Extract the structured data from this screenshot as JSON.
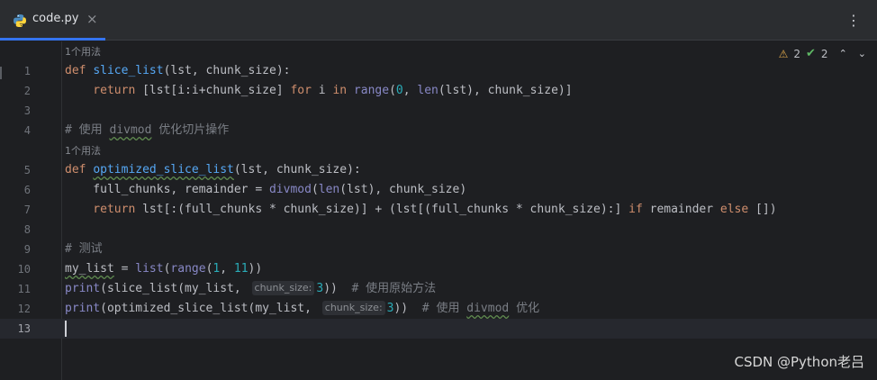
{
  "tab": {
    "label": "code.py",
    "close": "×"
  },
  "menu": {
    "kebab": "⋮"
  },
  "inspections": {
    "warnings": "2",
    "ok": "2",
    "up": "⌃",
    "down": "⌄"
  },
  "usage_hint": "1个用法",
  "inlay_hint": "chunk_size:",
  "lines": {
    "l1": {
      "n": "1",
      "a": "def ",
      "b": "slice_list",
      "c": "(lst, chunk_size):"
    },
    "l2": {
      "n": "2",
      "a": "    return ",
      "b": "[lst[i:i+chunk_size] ",
      "c": "for ",
      "d": "i ",
      "e": "in ",
      "f": "range",
      "g": "(",
      "h": "0",
      "i": ", ",
      "j": "len",
      "k": "(lst), chunk_size)]"
    },
    "l3": {
      "n": "3"
    },
    "l4": {
      "n": "4",
      "a": "# 使用 ",
      "b": "divmod",
      "c": " 优化切片操作"
    },
    "l5": {
      "n": "5",
      "a": "def ",
      "b": "optimized_slice_list",
      "c": "(lst, chunk_size):"
    },
    "l6": {
      "n": "6",
      "a": "    full_chunks, remainder = ",
      "b": "divmod",
      "c": "(",
      "d": "len",
      "e": "(lst), chunk_size)"
    },
    "l7": {
      "n": "7",
      "a": "    return ",
      "b": "lst[:(full_chunks * chunk_size)] + (lst[(full_chunks * chunk_size):] ",
      "c": "if ",
      "d": "remainder ",
      "e": "else ",
      "f": "[])"
    },
    "l8": {
      "n": "8"
    },
    "l9": {
      "n": "9",
      "a": "# 测试"
    },
    "l10": {
      "n": "10",
      "a": "my_list",
      "b": " = ",
      "c": "list",
      "d": "(",
      "e": "range",
      "f": "(",
      "g": "1",
      "h": ", ",
      "i": "11",
      "j": "))"
    },
    "l11": {
      "n": "11",
      "a": "print",
      "b": "(slice_list(my_list, ",
      "c": "3",
      "d": "))  ",
      "e": "# 使用原始方法"
    },
    "l12": {
      "n": "12",
      "a": "print",
      "b": "(optimized_slice_list(my_list, ",
      "c": "3",
      "d": "))  ",
      "e": "# 使用 ",
      "f": "divmod",
      "g": " 优化"
    },
    "l13": {
      "n": "13"
    }
  },
  "watermark": "CSDN @Python老吕",
  "colors": {
    "keyword": "#cf8e6d",
    "function": "#56a8f5",
    "number": "#2aacb8",
    "comment": "#7a7e85",
    "accent": "#3574f0"
  }
}
